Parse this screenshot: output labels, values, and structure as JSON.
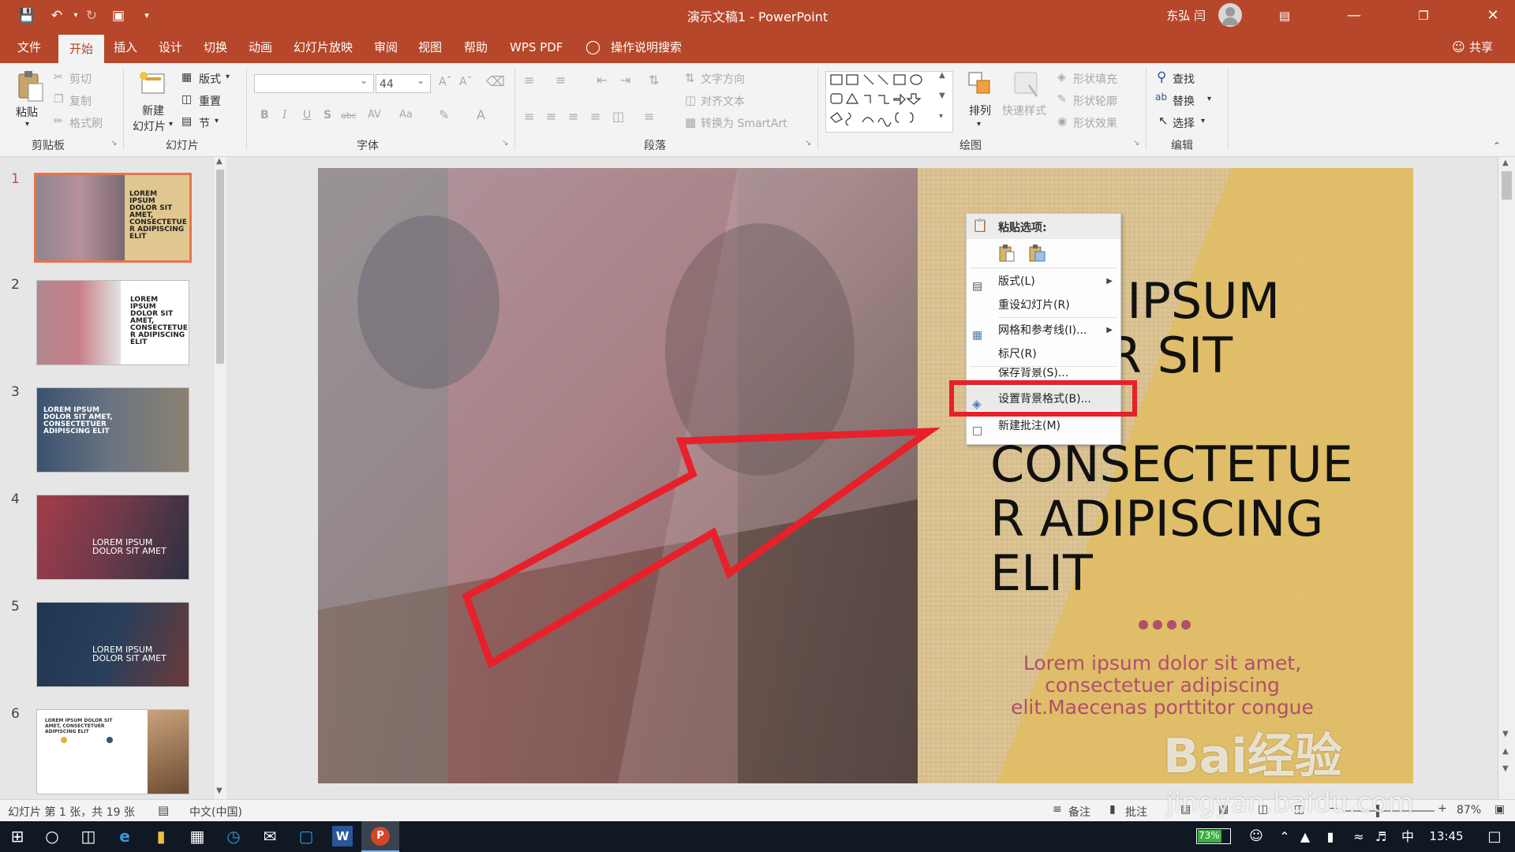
{
  "window": {
    "title": "演示文稿1 - PowerPoint",
    "user": "东弘 闫",
    "share": "共享"
  },
  "tabs": [
    "文件",
    "开始",
    "插入",
    "设计",
    "切换",
    "动画",
    "幻灯片放映",
    "审阅",
    "视图",
    "帮助",
    "WPS PDF"
  ],
  "tell_me": "操作说明搜索",
  "ribbon": {
    "clipboard": {
      "paste": "粘贴",
      "cut": "剪切",
      "copy": "复制",
      "format_painter": "格式刷",
      "group": "剪贴板"
    },
    "slides": {
      "new_slide_line1": "新建",
      "new_slide_line2": "幻灯片",
      "layout": "版式",
      "reset": "重置",
      "section": "节",
      "group": "幻灯片"
    },
    "font": {
      "font_name": "",
      "font_size": "44",
      "bold": "B",
      "italic": "I",
      "underline": "U",
      "shadow": "S",
      "strike": "abc",
      "spacing": "AV",
      "case": "Aa",
      "color": "A",
      "group": "字体"
    },
    "paragraph": {
      "text_direction": "文字方向",
      "align_text": "对齐文本",
      "smartart": "转换为 SmartArt",
      "group": "段落"
    },
    "drawing": {
      "arrange": "排列",
      "quick_styles": "快速样式",
      "shape_fill": "形状填充",
      "shape_outline": "形状轮廓",
      "shape_effects": "形状效果",
      "group": "绘图"
    },
    "editing": {
      "find": "查找",
      "replace": "替换",
      "select": "选择",
      "group": "编辑"
    }
  },
  "thumbnails": [
    {
      "num": "1",
      "text": "LOREM IPSUM DOLOR SIT AMET, CONSECTETUE R ADIPISCING ELIT"
    },
    {
      "num": "2",
      "text": "LOREM IPSUM DOLOR SIT AMET, CONSECTETUE R ADIPISCING ELIT"
    },
    {
      "num": "3",
      "text": "LOREM IPSUM DOLOR SIT AMET, CONSECTETUER ADIPISCING ELIT"
    },
    {
      "num": "4",
      "text": "LOREM IPSUM DOLOR SIT AMET"
    },
    {
      "num": "5",
      "text": "LOREM IPSUM DOLOR SIT AMET"
    },
    {
      "num": "6",
      "text": "LOREM IPSUM DOLOR SIT AMET, CONSECTETUER ADIPISCING ELIT"
    }
  ],
  "slide": {
    "title_lines": [
      "M IPSUM",
      "OR SIT",
      ",",
      "CONSECTETUE",
      "R ADIPISCING",
      "ELIT"
    ],
    "subtitle_lines": [
      "Lorem ipsum dolor sit amet,",
      "consectetuer adipiscing",
      "elit.Maecenas porttitor congue"
    ]
  },
  "context_menu": {
    "paste_options": "粘贴选项:",
    "items": [
      {
        "label": "版式(L)",
        "submenu": true
      },
      {
        "label": "重设幻灯片(R)",
        "submenu": false
      },
      {
        "label": "网格和参考线(I)...",
        "submenu": true
      },
      {
        "label": "标尺(R)",
        "submenu": false
      },
      {
        "label": "保存背景(S)...",
        "submenu": false
      },
      {
        "label": "设置背景格式(B)...",
        "submenu": false
      },
      {
        "label": "新建批注(M)",
        "submenu": false
      }
    ]
  },
  "statusbar": {
    "slide_info": "幻灯片 第 1 张，共 19 张",
    "language": "中文(中国)",
    "notes": "备注",
    "comments": "批注",
    "zoom": "87%"
  },
  "taskbar": {
    "battery": "73%",
    "ime": "中",
    "time": "13:45"
  },
  "watermark": {
    "text": "Bai经验",
    "url": "jingyan.baidu.com"
  },
  "colors": {
    "accent": "#b7472a",
    "highlight": "#e8202a",
    "slide_title": "#111111",
    "slide_subtitle": "#b0506a"
  }
}
